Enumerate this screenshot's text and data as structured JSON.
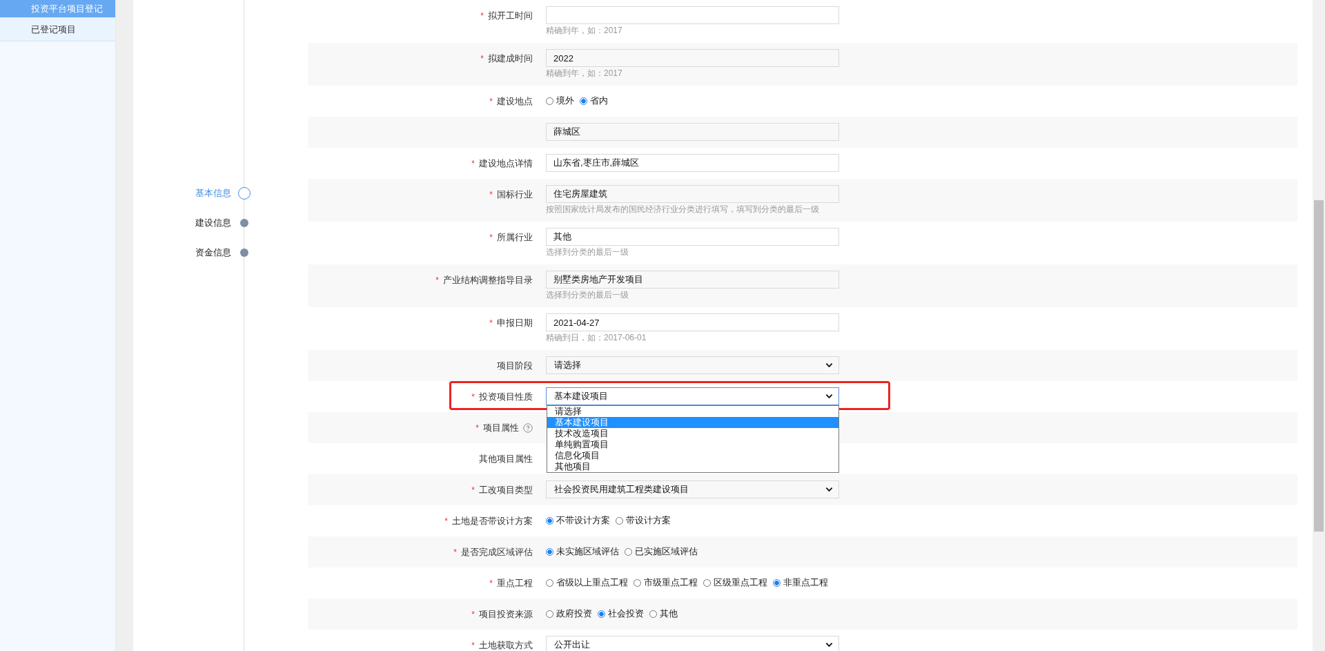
{
  "sidebar": {
    "items": [
      {
        "label": "投资平台项目登记",
        "selected": true
      },
      {
        "label": "已登记项目",
        "selected": false
      }
    ]
  },
  "steps": [
    {
      "label": "基本信息",
      "selected": true
    },
    {
      "label": "建设信息",
      "selected": false
    },
    {
      "label": "资金信息",
      "selected": false
    }
  ],
  "form": {
    "rows": [
      {
        "kind": "text",
        "label": "拟开工时间",
        "required_mark": "*",
        "value": "",
        "hint": "精确到年，如：2017"
      },
      {
        "kind": "text",
        "label": "拟建成时间",
        "required_mark": "*",
        "value": "2022",
        "hint": "精确到年，如：2017"
      },
      {
        "kind": "radio",
        "label": "建设地点",
        "required_mark": "*",
        "options": [
          {
            "label": "境外",
            "selected": false
          },
          {
            "label": "省内",
            "selected": true
          }
        ]
      },
      {
        "kind": "text",
        "label": "",
        "value": "薛城区"
      },
      {
        "kind": "text",
        "label": "建设地点详情",
        "required_mark": "*",
        "value": "山东省,枣庄市,薛城区"
      },
      {
        "kind": "text",
        "label": "国标行业",
        "required_mark": "*",
        "value": "住宅房屋建筑",
        "hint": "按照国家统计局发布的国民经济行业分类进行填写，填写到分类的最后一级"
      },
      {
        "kind": "text",
        "label": "所属行业",
        "required_mark": "*",
        "value": "其他",
        "hint": "选择到分类的最后一级"
      },
      {
        "kind": "text",
        "label": "产业结构调整指导目录",
        "required_mark": "*",
        "value": "别墅类房地产开发项目",
        "hint": "选择到分类的最后一级"
      },
      {
        "kind": "text",
        "label": "申报日期",
        "required_mark": "*",
        "value": "2021-04-27",
        "hint": "精确到日，如：2017-06-01"
      },
      {
        "kind": "select",
        "label": "项目阶段",
        "value": "请选择"
      },
      {
        "kind": "select",
        "label": "投资项目性质",
        "required_mark": "*",
        "value": "基本建设项目",
        "highlighted": true,
        "open": true,
        "options": [
          {
            "label": "请选择",
            "selected": false
          },
          {
            "label": "基本建设项目",
            "selected": true
          },
          {
            "label": "技术改造项目",
            "selected": false
          },
          {
            "label": "单纯购置项目",
            "selected": false
          },
          {
            "label": "信息化项目",
            "selected": false
          },
          {
            "label": "其他项目",
            "selected": false
          }
        ]
      },
      {
        "kind": "blank",
        "label": "项目属性",
        "required_mark": "*",
        "help": true
      },
      {
        "kind": "blank",
        "label": "其他项目属性"
      },
      {
        "kind": "select",
        "label": "工改项目类型",
        "required_mark": "*",
        "value": "社会投资民用建筑工程类建设项目"
      },
      {
        "kind": "radio",
        "label": "土地是否带设计方案",
        "required_mark": "*",
        "options": [
          {
            "label": "不带设计方案",
            "selected": true
          },
          {
            "label": "带设计方案",
            "selected": false
          }
        ]
      },
      {
        "kind": "radio",
        "label": "是否完成区域评估",
        "required_mark": "*",
        "options": [
          {
            "label": "未实施区域评估",
            "selected": true
          },
          {
            "label": "已实施区域评估",
            "selected": false
          }
        ]
      },
      {
        "kind": "radio",
        "label": "重点工程",
        "required_mark": "*",
        "options": [
          {
            "label": "省级以上重点工程",
            "selected": false
          },
          {
            "label": "市级重点工程",
            "selected": false
          },
          {
            "label": "区级重点工程",
            "selected": false
          },
          {
            "label": "非重点工程",
            "selected": true
          }
        ]
      },
      {
        "kind": "radio",
        "label": "项目投资来源",
        "required_mark": "*",
        "options": [
          {
            "label": "政府投资",
            "selected": false
          },
          {
            "label": "社会投资",
            "selected": true
          },
          {
            "label": "其他",
            "selected": false
          }
        ]
      },
      {
        "kind": "select",
        "label": "土地获取方式",
        "required_mark": "*",
        "value": "公开出让"
      }
    ]
  }
}
